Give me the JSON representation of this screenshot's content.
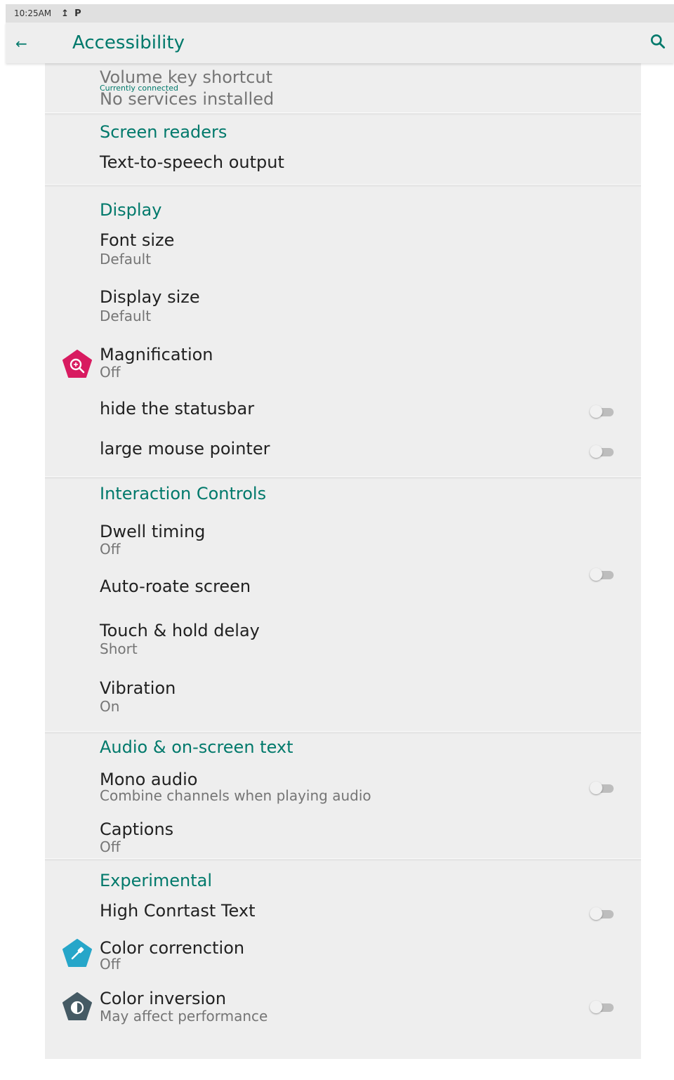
{
  "status_bar": {
    "time": "10:25AM",
    "icons": [
      "upload-icon",
      "parking-icon"
    ]
  },
  "app_bar": {
    "back_icon": "arrow-back-icon",
    "title": "Accessibility",
    "search_icon": "search-icon"
  },
  "colors": {
    "accent": "#00796b",
    "magnification_icon": "#d81b60",
    "color_correction_icon": "#26a6c9",
    "color_inversion_icon": "#455a64"
  },
  "sections": {
    "services": {
      "volume_key_shortcut": "Volume key shortcut",
      "currently_connected": "Currently connected",
      "no_services": "No services installed"
    },
    "screen_readers": {
      "header": "Screen readers",
      "tts": "Text-to-speech output"
    },
    "display": {
      "header": "Display",
      "font_size": {
        "title": "Font size",
        "summary": "Default"
      },
      "display_size": {
        "title": "Display size",
        "summary": "Default"
      },
      "magnification": {
        "title": "Magnification",
        "summary": "Off",
        "icon": "magnifier-plus-icon"
      },
      "hide_statusbar": {
        "title": "hide the statusbar",
        "checked": false
      },
      "large_pointer": {
        "title": "large mouse pointer",
        "checked": false
      }
    },
    "interaction": {
      "header": "Interaction Controls",
      "dwell": {
        "title": "Dwell timing",
        "summary": "Off"
      },
      "auto_rotate": {
        "title": "Auto-roate screen",
        "checked": false
      },
      "touch_hold": {
        "title": "Touch & hold delay",
        "summary": "Short"
      },
      "vibration": {
        "title": "Vibration",
        "summary": "On"
      }
    },
    "audio": {
      "header": "Audio & on-screen text",
      "mono": {
        "title": "Mono audio",
        "summary": "Combine channels when playing audio",
        "checked": false
      },
      "captions": {
        "title": "Captions",
        "summary": "Off"
      }
    },
    "experimental": {
      "header": "Experimental",
      "high_contrast": {
        "title": "High Conrtast Text",
        "checked": false
      },
      "color_correction": {
        "title": "Color correnction",
        "summary": "Off",
        "icon": "eyedropper-icon"
      },
      "color_inversion": {
        "title": "Color inversion",
        "summary": "May affect performance",
        "icon": "half-circle-icon",
        "checked": false
      }
    }
  }
}
